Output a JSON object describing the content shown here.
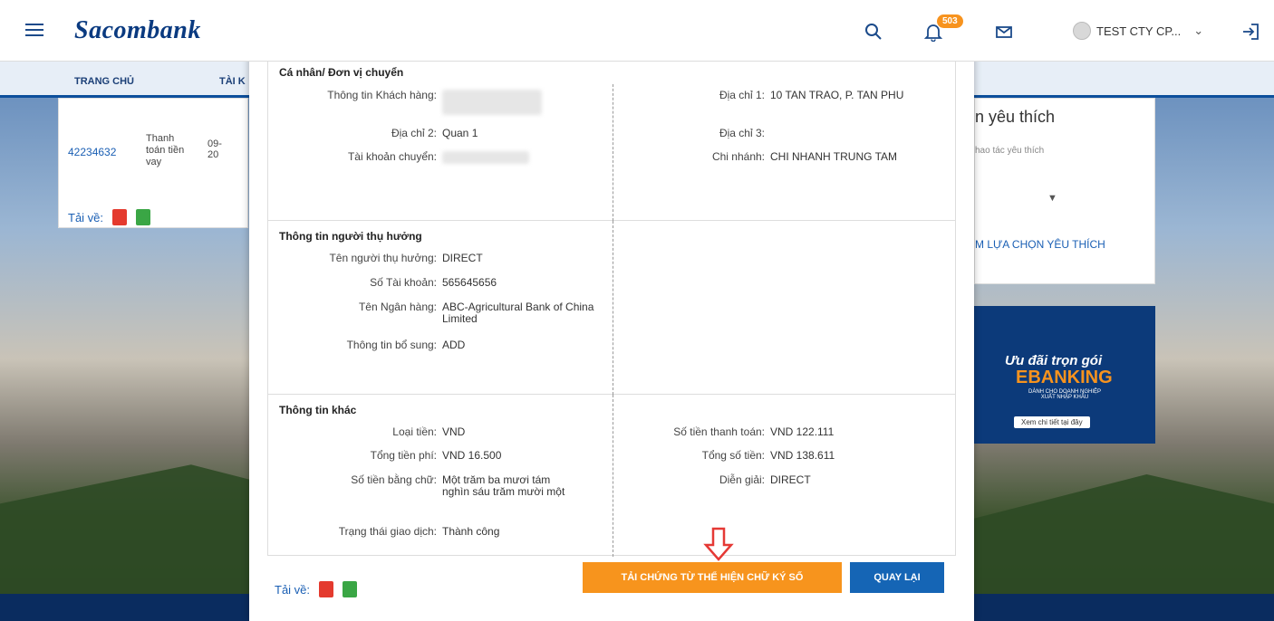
{
  "header": {
    "logo": "Sacombank",
    "notifications_count": "503",
    "user_name": "TEST CTY CP...",
    "icons": [
      "menu-icon",
      "search-icon",
      "bell-icon",
      "mail-icon",
      "avatar-icon",
      "chevron-down-icon",
      "logout-icon"
    ]
  },
  "nav": {
    "items": [
      "TRANG CHỦ",
      "TÀI K"
    ]
  },
  "background_left": {
    "acct_number": "42234632",
    "type_line1": "Thanh",
    "type_line2": "toán tiền",
    "type_line3": "vay",
    "date": "09-",
    "date2": "20",
    "download_label": "Tải về:"
  },
  "background_right": {
    "title": "n yêu thích",
    "hint": "hao tác yêu thích",
    "link": "M LỰA CHỌN YÊU THÍCH"
  },
  "promo": {
    "line1": "Ưu đãi trọn gói",
    "line2": "EBANKING",
    "line3": "DÀNH CHO DOANH NGHIỆP XUẤT NHẬP KHẨU",
    "button": "Xem chi tiết tại đây"
  },
  "sender": {
    "title": "Cá nhân/ Đơn vị chuyển",
    "customer_info_label": "Thông tin Khách hàng:",
    "address1_label": "Địa chỉ 1:",
    "address1": "10 TAN TRAO, P. TAN PHU",
    "address2_label": "Địa chỉ 2:",
    "address2": "Quan 1",
    "address3_label": "Địa chỉ 3:",
    "from_account_label": "Tài khoản chuyển:",
    "branch_label": "Chi nhánh:",
    "branch": "CHI NHANH TRUNG TAM"
  },
  "beneficiary": {
    "title": "Thông tin người thụ hưởng",
    "name_label": "Tên người thụ hưởng:",
    "name": "DIRECT",
    "account_label": "Số Tài khoản:",
    "account": "565645656",
    "bank_label": "Tên Ngân hàng:",
    "bank": "ABC-Agricultural Bank of China Limited",
    "extra_label": "Thông tin bổ sung:",
    "extra": "ADD"
  },
  "other": {
    "title": "Thông tin khác",
    "currency_label": "Loại tiền:",
    "currency": "VND",
    "payment_label": "Số tiền thanh toán:",
    "payment": "VND 122.111",
    "fee_label": "Tổng tiền phí:",
    "fee": "VND 16.500",
    "total_label": "Tổng số tiền:",
    "total": "VND 138.611",
    "words_label": "Số tiền bằng chữ:",
    "words": "Một trăm ba mươi tám nghìn sáu trăm mười một",
    "desc_label": "Diễn giải:",
    "desc": "DIRECT",
    "status_label": "Trạng thái giao dịch:",
    "status": "Thành công"
  },
  "actions": {
    "download_label": "Tải về:",
    "sign_button": "TẢI CHỨNG TỪ THỂ HIỆN CHỮ KÝ SỐ",
    "back_button": "QUAY LẠI"
  }
}
